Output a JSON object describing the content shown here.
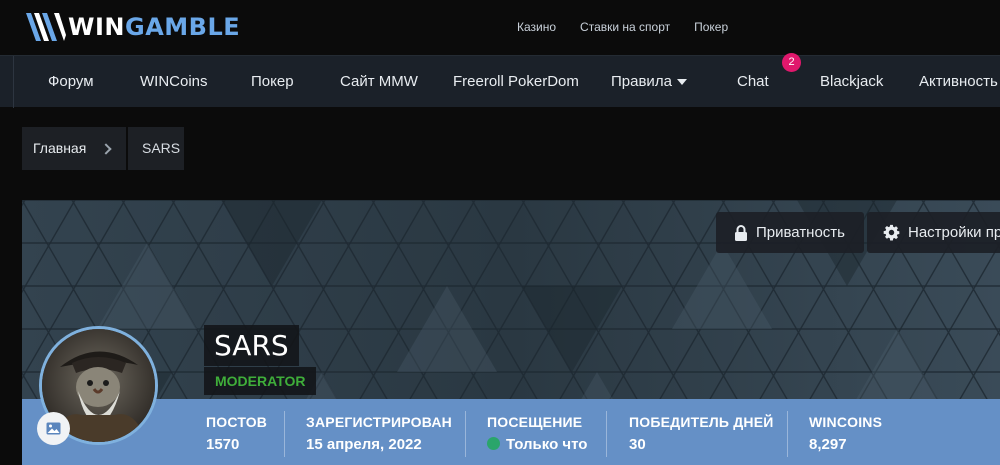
{
  "site": {
    "logo_win": "WIN",
    "logo_gamble": "GAMBLE"
  },
  "top_links": [
    "Казино",
    "Ставки на спорт",
    "Покер"
  ],
  "nav": {
    "items": [
      "Форум",
      "WINCoins",
      "Покер",
      "Сайт MMW",
      "Freeroll PokerDom",
      "Правила",
      "Chat",
      "Blackjack",
      "Активность"
    ],
    "chat_badge": "2"
  },
  "breadcrumb": {
    "home": "Главная",
    "current": "SARS"
  },
  "cover": {
    "privacy_label": "Приватность",
    "settings_label": "Настройки пр"
  },
  "profile": {
    "username": "SARS",
    "role": "MODERATOR"
  },
  "stats": [
    {
      "label": "ПОСТОВ",
      "value": "1570"
    },
    {
      "label": "ЗАРЕГИСТРИРОВАН",
      "value": "15 апреля, 2022"
    },
    {
      "label": "ПОСЕЩЕНИЕ",
      "value": "Только что"
    },
    {
      "label": "ПОБЕДИТЕЛЬ ДНЕЙ",
      "value": "30"
    },
    {
      "label": "WINCOINS",
      "value": "8,297"
    }
  ],
  "colors": {
    "accent": "#6590c6",
    "badge": "#e0186c",
    "moderator": "#3fae3a",
    "online": "#2aa56b"
  },
  "icons": [
    "wingamble-logo-icon",
    "lock-icon",
    "gear-icon",
    "image-icon",
    "chevron-right-icon",
    "caret-down-icon"
  ]
}
